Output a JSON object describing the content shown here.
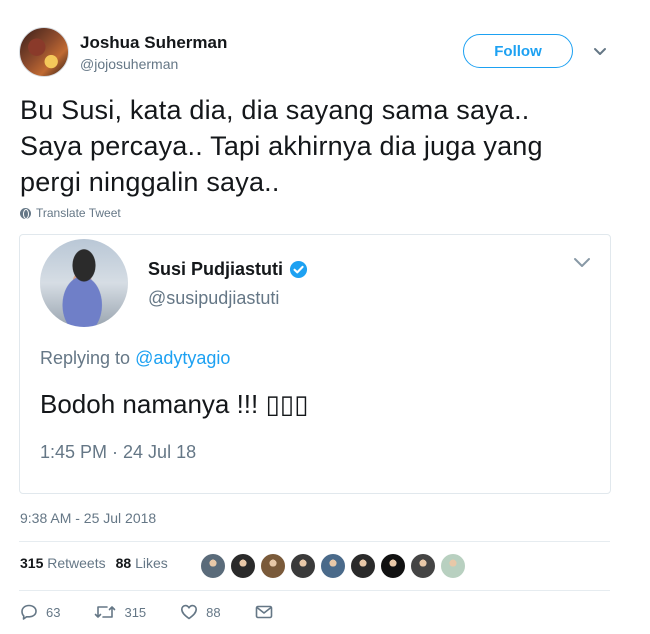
{
  "author": {
    "name": "Joshua Suherman",
    "handle": "@jojosuherman"
  },
  "follow_label": "Follow",
  "tweet": {
    "lines": [
      "Bu Susi, kata dia, dia sayang sama saya..",
      "Saya percaya.. Tapi akhirnya dia juga yang",
      "pergi ninggalin saya.."
    ],
    "translate_label": "Translate Tweet",
    "timestamp": "9:38 AM - 25 Jul 2018"
  },
  "quoted": {
    "name": "Susi Pudjiastuti",
    "handle": "@susipudjiastuti",
    "replying_prefix": "Replying to",
    "replying_to": "@adytyagio",
    "text": "Bodoh namanya !!! ▯▯▯",
    "time": "1:45 PM · 24 Jul 18"
  },
  "stats": {
    "retweets_count": "315",
    "retweets_label": "Retweets",
    "likes_count": "88",
    "likes_label": "Likes"
  },
  "likers": [
    {
      "color": "#5a6b7a"
    },
    {
      "color": "#2a2a2a"
    },
    {
      "color": "#7a5a3a"
    },
    {
      "color": "#3a3a3a"
    },
    {
      "color": "#4a6a8a"
    },
    {
      "color": "#2a2a2a"
    },
    {
      "color": "#111111"
    },
    {
      "color": "#444444"
    },
    {
      "color": "#b8d0c0"
    }
  ],
  "actions": {
    "reply_count": "63",
    "retweet_count": "315",
    "like_count": "88"
  },
  "colors": {
    "accent": "#1da1f2",
    "text": "#14171a",
    "muted": "#657786"
  }
}
